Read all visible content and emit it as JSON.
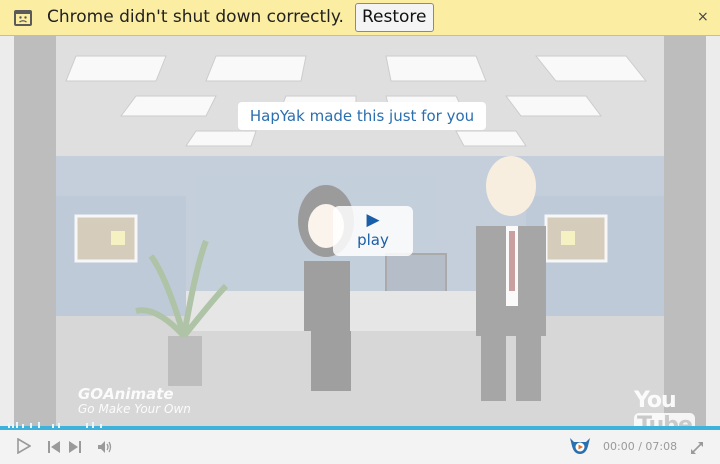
{
  "infobar": {
    "message": "Chrome didn't shut down correctly.",
    "restore_label": "Restore",
    "close_glyph": "×",
    "icon": "crashed-window-icon"
  },
  "video": {
    "hapyak_banner": "HapYak made this just for you",
    "play_glyph": "▶",
    "play_label": "play",
    "watermark_brand": "GOAnimate",
    "watermark_tagline": "Go Make Your Own",
    "youtube_logo_you": "You",
    "youtube_logo_tube": "Tube"
  },
  "controls": {
    "current_time": "00:00",
    "separator": "/",
    "duration": "07:08",
    "progress_fraction": 0.0,
    "buffered_fraction": 1.0,
    "icons": [
      "play-icon",
      "previous-icon",
      "next-icon",
      "volume-icon",
      "hapyak-logo-icon",
      "fullscreen-icon"
    ]
  },
  "colors": {
    "infobar_bg": "#fbeda2",
    "link_blue": "#2a6fb0",
    "progress_blue": "#3fb2dc",
    "control_grey": "#9a9a9a"
  }
}
